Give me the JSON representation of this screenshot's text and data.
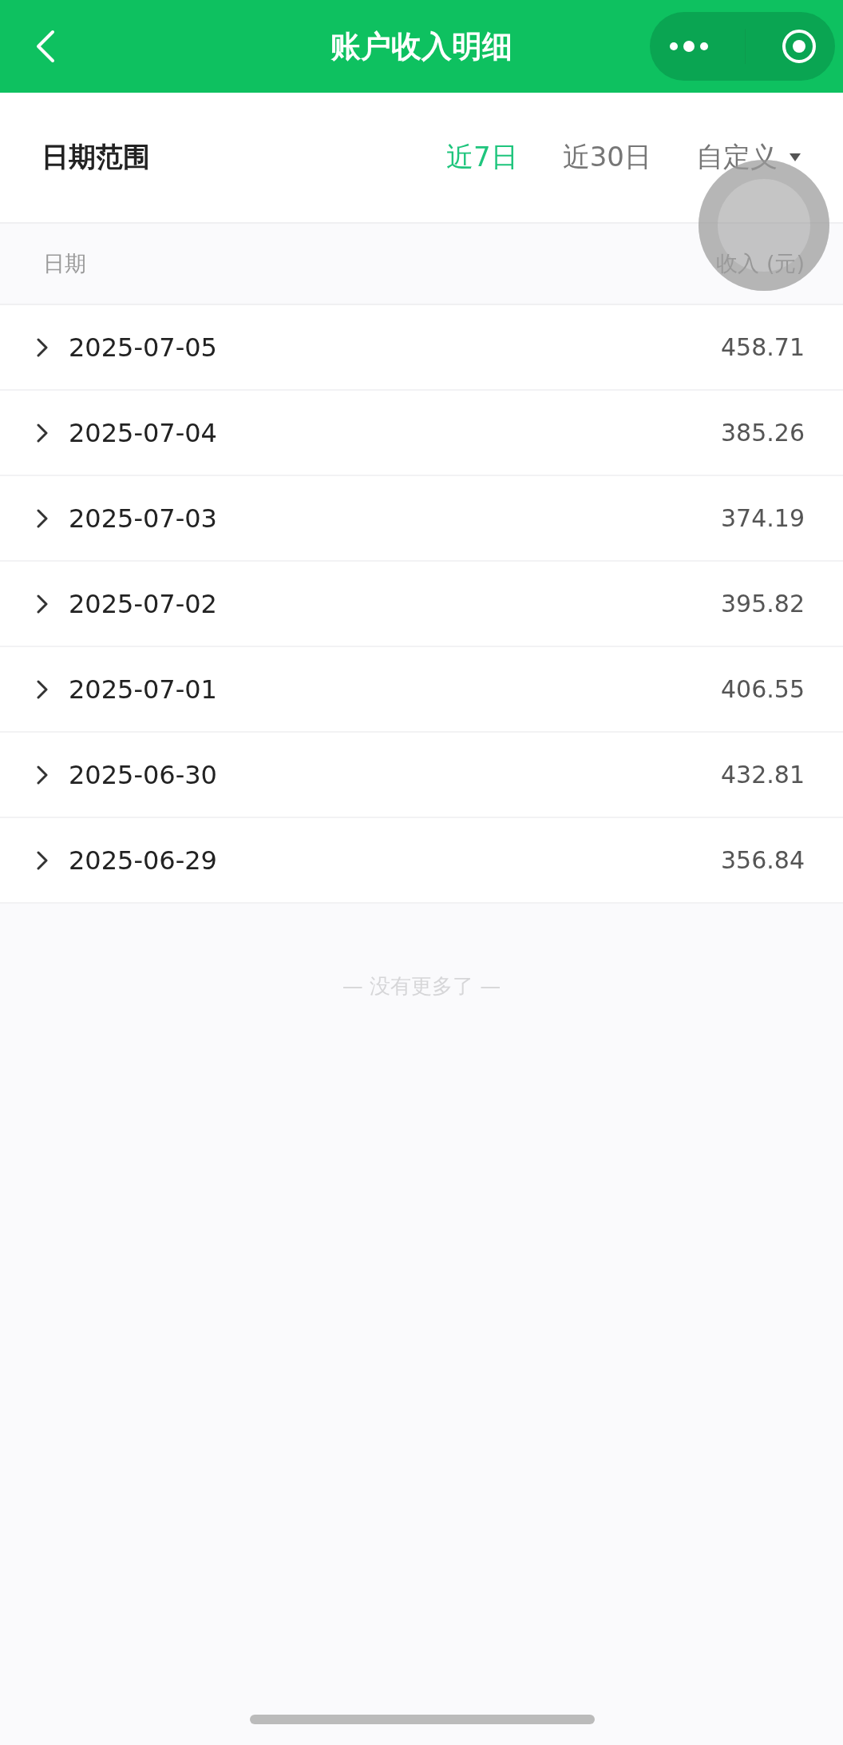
{
  "header": {
    "title": "账户收入明细"
  },
  "filter": {
    "label": "日期范围",
    "options": [
      {
        "label": "近7日",
        "selected": true,
        "kind": "tab"
      },
      {
        "label": "近30日",
        "selected": false,
        "kind": "tab"
      },
      {
        "label": "自定义",
        "selected": false,
        "kind": "dropdown"
      }
    ]
  },
  "table": {
    "columns": [
      "日期",
      "收入 (元)"
    ],
    "rows": [
      {
        "date": "2025-07-05",
        "income": "458.71"
      },
      {
        "date": "2025-07-04",
        "income": "385.26"
      },
      {
        "date": "2025-07-03",
        "income": "374.19"
      },
      {
        "date": "2025-07-02",
        "income": "395.82"
      },
      {
        "date": "2025-07-01",
        "income": "406.55"
      },
      {
        "date": "2025-06-30",
        "income": "432.81"
      },
      {
        "date": "2025-06-29",
        "income": "356.84"
      }
    ]
  },
  "end_note": "— 没有更多了 —"
}
